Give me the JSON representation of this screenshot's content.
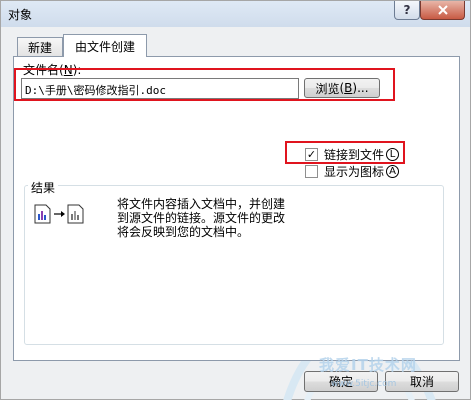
{
  "window": {
    "title": "对象"
  },
  "tabs": [
    {
      "label": "新建",
      "active": false
    },
    {
      "label": "由文件创建",
      "active": true
    }
  ],
  "filename": {
    "label": "文件名",
    "shortcut": "N",
    "suffix": ":",
    "value": "D:\\手册\\密码修改指引.doc"
  },
  "browse": {
    "label": "浏览",
    "shortcut": "B",
    "suffix": "..."
  },
  "options": {
    "link": {
      "label": "链接到文件",
      "shortcut": "L",
      "checked": true
    },
    "icon": {
      "label": "显示为图标",
      "shortcut": "A",
      "checked": false
    }
  },
  "result": {
    "label": "结果",
    "description": "将文件内容插入文档中，并创建到源文件的链接。源文件的更改将会反映到您的文档中。"
  },
  "buttons": {
    "ok": "确定",
    "cancel": "取消"
  },
  "watermark": {
    "text": "我爱IT技术网",
    "sub": "www.5itjc.com"
  },
  "colors": {
    "highlight": "#e0141e",
    "titlebar": "#d5e1ef"
  },
  "icons": {
    "help": "help-icon",
    "close": "close-icon",
    "result": "linked-document-icon"
  }
}
